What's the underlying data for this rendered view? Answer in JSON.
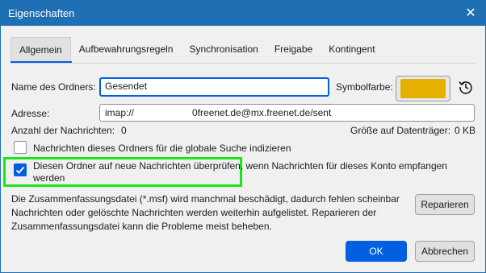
{
  "window": {
    "title": "Eigenschaften"
  },
  "tabs": [
    {
      "label": "Allgemein",
      "active": true
    },
    {
      "label": "Aufbewahrungsregeln",
      "active": false
    },
    {
      "label": "Synchronisation",
      "active": false
    },
    {
      "label": "Freigabe",
      "active": false
    },
    {
      "label": "Kontingent",
      "active": false
    }
  ],
  "general": {
    "folder_name_label": "Name des Ordners:",
    "folder_name_value": "Gesendet",
    "symbol_color_label": "Symbolfarbe:",
    "symbol_color": "#e6b000",
    "address_label": "Adresse:",
    "address_prefix": "imap://",
    "address_suffix": "0freenet.de@mx.freenet.de/sent",
    "message_count_label": "Anzahl der Nachrichten:",
    "message_count_value": "0",
    "disk_size_label": "Größe auf Datenträger:",
    "disk_size_value": "0 KB",
    "index_checkbox_label": "Nachrichten dieses Ordners für die globale Suche indizieren",
    "index_checked": false,
    "check_new_line1": "Diesen Ordner auf neue Nachrichten überprüfen, wenn Nachrichten für dieses Konto empfangen",
    "check_new_line2": "werden",
    "check_new_checked": true,
    "summary_text_line1": "Die Zusammenfassungsdatei (*.msf) wird manchmal beschädigt, dadurch fehlen scheinbar",
    "summary_text_line2": "Nachrichten oder gelöschte Nachrichten werden weiterhin aufgelistet. Reparieren der",
    "summary_text_line3": "Zusammenfassungsdatei kann die Probleme meist beheben.",
    "repair_button": "Reparieren"
  },
  "footer": {
    "ok_button": "OK",
    "cancel_button": "Abbrechen"
  },
  "colors": {
    "accent": "#0060df",
    "titlebar": "#1f6fb4",
    "highlight_frame": "#19e619"
  }
}
